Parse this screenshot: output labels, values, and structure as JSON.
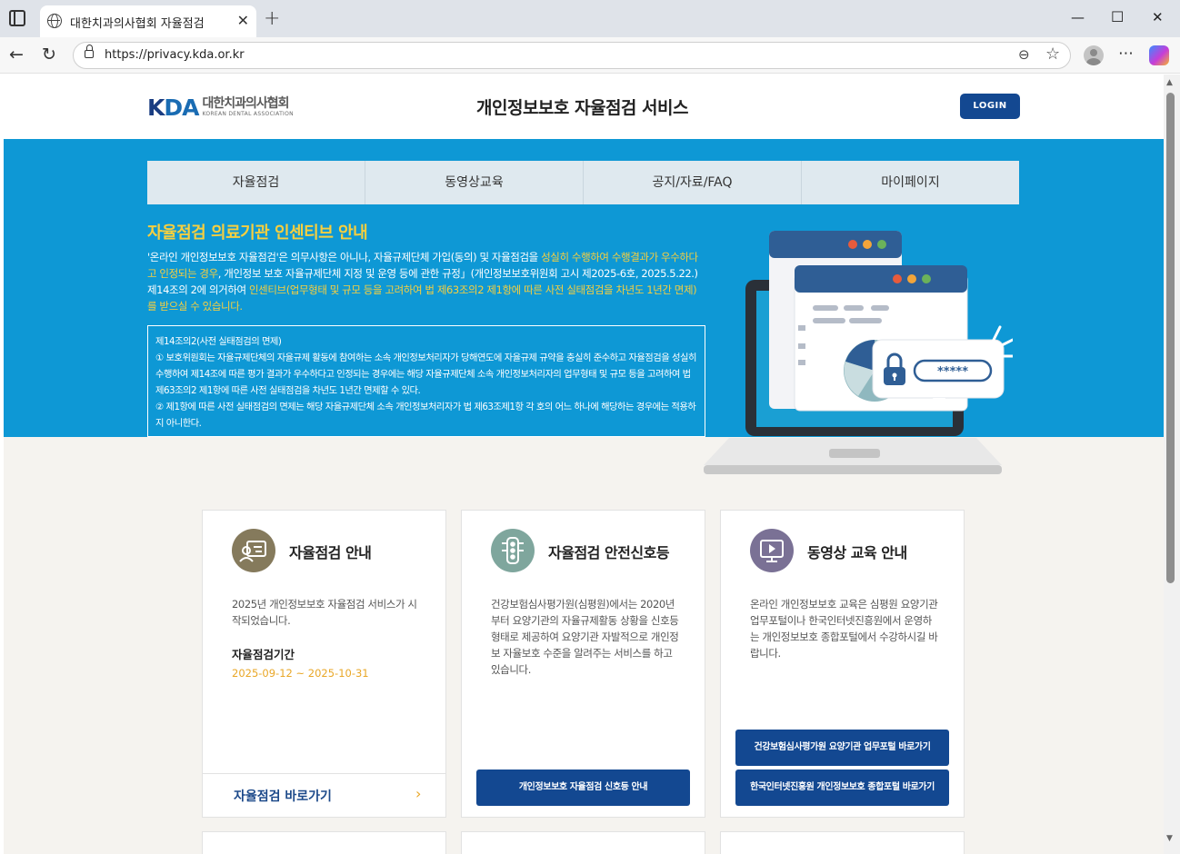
{
  "browser": {
    "tab_title": "대한치과의사협회 자율점검",
    "url": "https://privacy.kda.or.kr",
    "icons": [
      "tab-strip-icon",
      "globe-icon",
      "close-icon",
      "plus-icon",
      "minimize-icon",
      "maximize-icon",
      "window-close-icon",
      "back-icon",
      "refresh-icon",
      "lock-icon",
      "zoom-icon",
      "star-icon",
      "profile-icon",
      "more-icon",
      "copilot-icon"
    ]
  },
  "header": {
    "logo_mark_1": "K",
    "logo_mark_2": "DA",
    "logo_ko": "대한치과의사협회",
    "logo_en": "KOREAN DENTAL ASSOCIATION",
    "title": "개인정보보호 자율점검 서비스",
    "login": "LOGIN"
  },
  "nav": {
    "items": [
      "자율점검",
      "동영상교육",
      "공지/자료/FAQ",
      "마이페이지"
    ]
  },
  "hero": {
    "heading": "자율점검 의료기관 인센티브 안내",
    "body_1": "'온라인 개인정보보호 자율점검'은 의무사항은 아니나, 자율규제단체 가입(동의) 및 자율점검을 ",
    "body_hl_1": "성실히 수행하여 수행결과가 우수하다고 인정되는 경우",
    "body_2": ", 개인정보 보호 자율규제단체 지정 및 운영 등에 관한 규정」(개인정보보호위원회 고시 제2025-6호, 2025.5.22.) 제14조의 2에 의거하여 ",
    "body_hl_2": "인센티브(업무형태 및 규모 등을 고려하여 법 제63조의2 제1항에 따른 사전 실태점검을 차년도 1년간 면제)를 받으실 수 있습니다.",
    "article_title": "제14조의2(사전 실태점검의 면제)",
    "article_1": "① 보호위원회는 자율규제단체의 자율규제 활동에 참여하는 소속 개인정보처리자가 당해연도에 자율규제 규약을 충실히 준수하고 자율점검을 성실히 수행하여 제14조에 따른 평가 결과가 우수하다고 인정되는 경우에는 해당 자율규제단체 소속 개인정보처리자의 업무형태 및 규모 등을 고려하여 법 제63조의2 제1항에 따른 사전 실태점검을 차년도 1년간 면제할 수 있다.",
    "article_2": "② 제1항에 따른 사전 실태점검의 면제는 해당 자율규제단체 소속 개인정보처리자가 법 제63조제1항 각 호의 어느 하나에 해당하는 경우에는 적용하지 아니한다.",
    "password_mask": "*****"
  },
  "cards": [
    {
      "title": "자율점검 안내",
      "desc": "2025년 개인정보보호 자율점검 서비스가 시작되었습니다.",
      "sub": "자율점검기간",
      "date": "2025-09-12 ~ 2025-10-31",
      "link": "자율점검 바로가기",
      "icon_color": "#857a5c"
    },
    {
      "title": "자율점검 안전신호등",
      "desc": "건강보험심사평가원(심평원)에서는 2020년 부터 요양기관의 자율규제활동 상황을 신호등 형태로 제공하여 요양기관 자발적으로 개인정보 자율보호 수준을 알려주는 서비스를 하고 있습니다.",
      "button": "개인정보보호 자율점검 신호등 안내",
      "icon_color": "#7fa69d"
    },
    {
      "title": "동영상 교육 안내",
      "desc": "온라인 개인정보보호 교육은 심평원 요양기관 업무포털이나 한국인터넷진흥원에서 운영하는 개인정보보호 종합포털에서 수강하시길 바랍니다.",
      "button_1": "건강보험심사평가원 요양기관 업무포털 바로가기",
      "button_2": "한국인터넷진흥원 개인정보보호 종합포털 바로가기",
      "icon_color": "#7a7195"
    }
  ],
  "colors": {
    "hero_bg": "#0e98d5",
    "accent_yellow": "#f7cf3f",
    "primary_navy": "#134891"
  }
}
